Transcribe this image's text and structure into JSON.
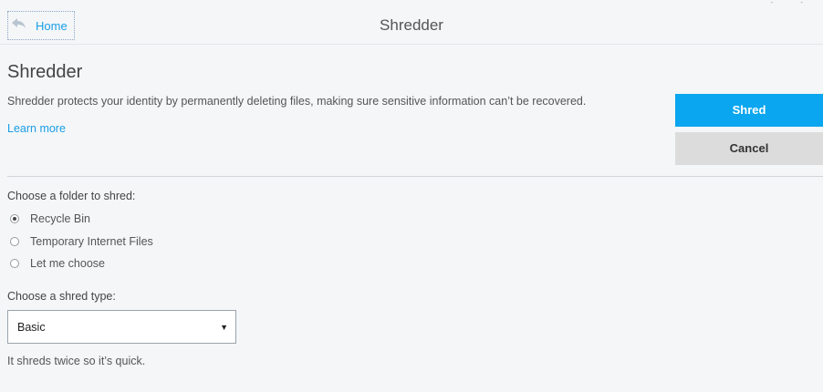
{
  "header": {
    "home_label": "Home",
    "window_title": "Shredder"
  },
  "main": {
    "title": "Shredder",
    "description": "Shredder protects your identity by permanently deleting files, making sure sensitive information can’t be recovered.",
    "learn_more": "Learn more"
  },
  "actions": {
    "shred_label": "Shred",
    "cancel_label": "Cancel"
  },
  "folder_section": {
    "label": "Choose a folder to shred:",
    "options": [
      {
        "label": "Recycle Bin",
        "selected": true
      },
      {
        "label": "Temporary Internet Files",
        "selected": false
      },
      {
        "label": "Let me choose",
        "selected": false
      }
    ]
  },
  "type_section": {
    "label": "Choose a shred type:",
    "selected": "Basic",
    "hint": "It shreds twice so it’s quick."
  },
  "colors": {
    "accent": "#0aa6ef",
    "link": "#1a9ee6",
    "background": "#f4f6f8"
  }
}
